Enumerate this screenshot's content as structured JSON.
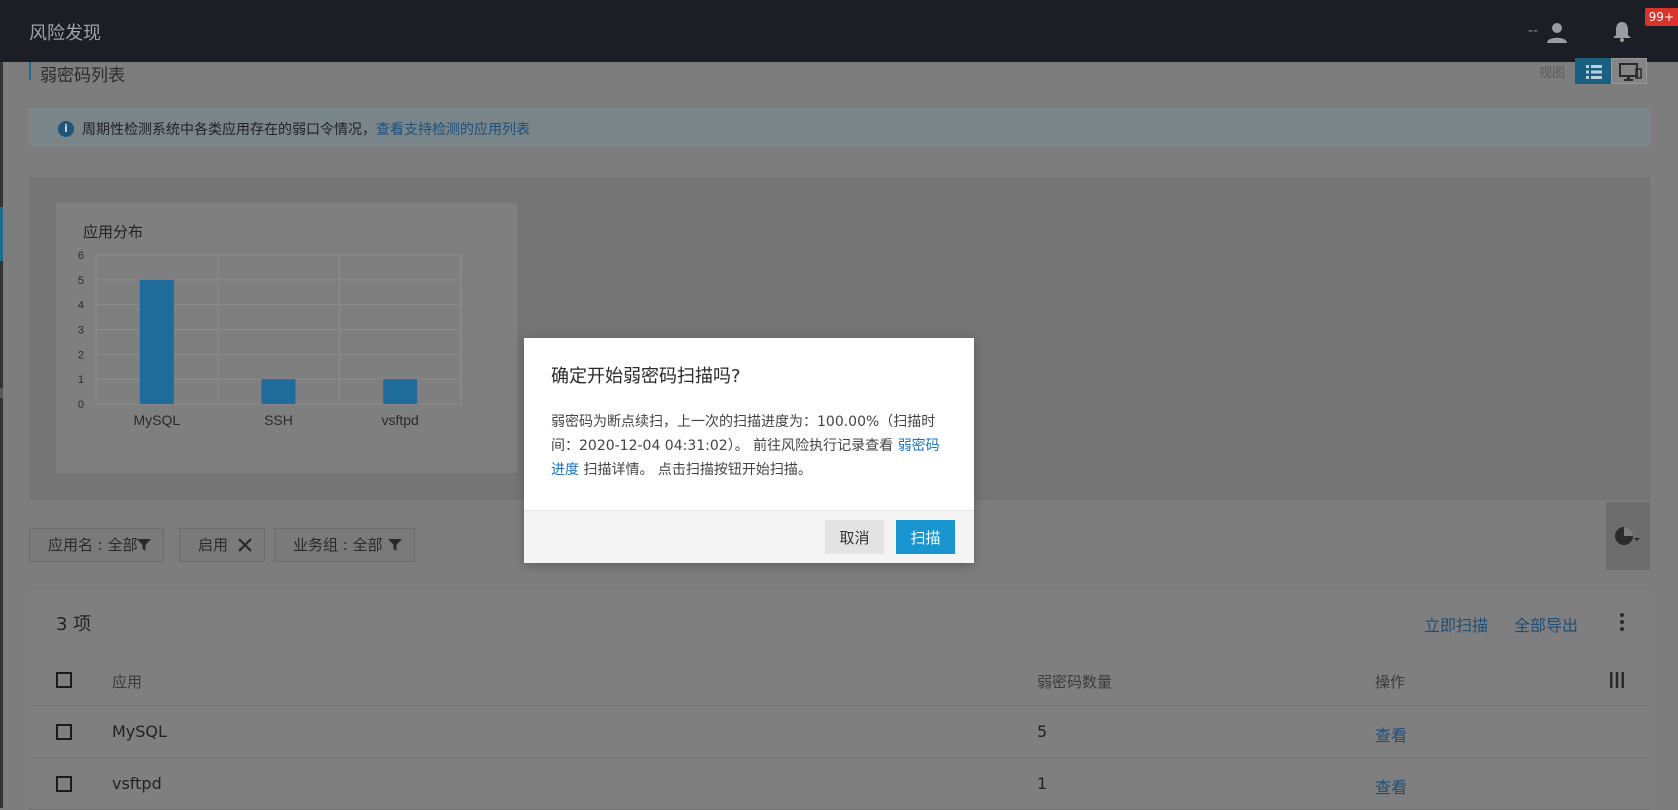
{
  "header": {
    "title": "风险发现",
    "user_name": "--",
    "notification_badge": "99+"
  },
  "page": {
    "title": "弱密码列表",
    "view_label": "视图"
  },
  "banner": {
    "text": "周期性检测系统中各类应用存在的弱口令情况，",
    "link": "查看支持检测的应用列表"
  },
  "chart": {
    "title": "应用分布"
  },
  "chart_data": {
    "type": "bar",
    "title": "应用分布",
    "categories": [
      "MySQL",
      "SSH",
      "vsftpd"
    ],
    "values": [
      5,
      1,
      1
    ],
    "ylim": [
      0,
      6
    ],
    "yticks": [
      "0",
      "1",
      "2",
      "3",
      "4",
      "5",
      "6"
    ],
    "grid": true,
    "bar_color": "#1f6c9a"
  },
  "filters": [
    {
      "label": "应用名 : 全部",
      "icon": "filter-icon"
    },
    {
      "label": "启用",
      "icon": "close-icon"
    },
    {
      "label": "业务组 : 全部",
      "icon": "filter-icon"
    }
  ],
  "table": {
    "count_label": "3 项",
    "actions": {
      "scan_now": "立即扫描",
      "export_all": "全部导出"
    },
    "columns": {
      "app": "应用",
      "count": "弱密码数量",
      "ops": "操作"
    },
    "rows": [
      {
        "app": "MySQL",
        "count": "5",
        "op": "查看"
      },
      {
        "app": "vsftpd",
        "count": "1",
        "op": "查看"
      }
    ]
  },
  "modal": {
    "title": "确定开始弱密码扫描吗?",
    "body_part1": "弱密码为断点续扫，上一次的扫描进度为：100.00%（扫描时间：2020-12-04 04:31:02）。 前往风险执行记录查看 ",
    "body_link": "弱密码进度",
    "body_part2": " 扫描详情。 点击扫描按钮开始扫描。",
    "cancel": "取消",
    "confirm": "扫描"
  },
  "colors": {
    "accent": "#1996d0",
    "link": "#1a74c6",
    "badge": "#d9342b"
  }
}
